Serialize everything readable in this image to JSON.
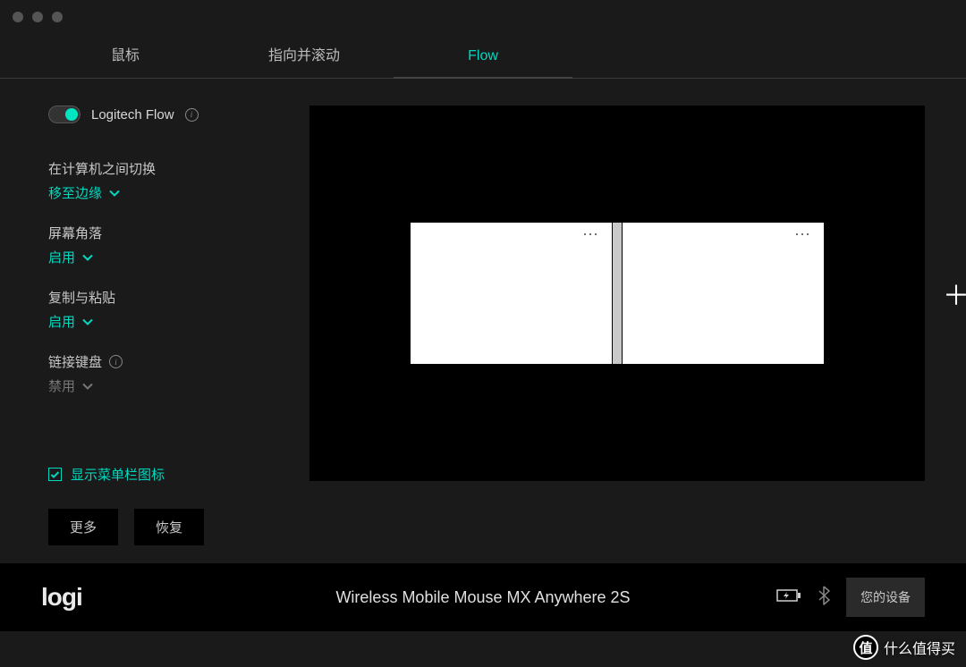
{
  "titlebar": {},
  "tabs": {
    "mouse": "鼠标",
    "point_scroll": "指向并滚动",
    "flow": "Flow"
  },
  "sidebar": {
    "flow_label": "Logitech Flow",
    "settings": {
      "switch": {
        "title": "在计算机之间切换",
        "value": "移至边缘"
      },
      "corners": {
        "title": "屏幕角落",
        "value": "启用"
      },
      "copypaste": {
        "title": "复制与粘贴",
        "value": "启用"
      },
      "keyboard": {
        "title": "链接键盘",
        "value": "禁用"
      }
    },
    "show_menubar_icon": "显示菜单栏图标",
    "buttons": {
      "more": "更多",
      "restore": "恢复"
    }
  },
  "canvas": {
    "monitor1_menu": "⋯",
    "monitor2_menu": "⋯",
    "add": "＋"
  },
  "footer": {
    "logo": "logi",
    "device": "Wireless Mobile Mouse MX Anywhere 2S",
    "your_device": "您的设备"
  },
  "watermark": {
    "badge": "值",
    "text": "什么值得买"
  }
}
